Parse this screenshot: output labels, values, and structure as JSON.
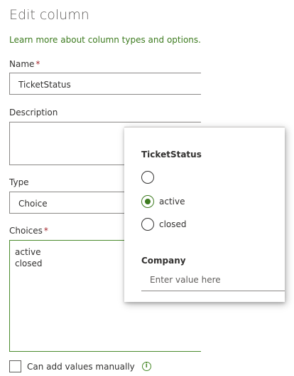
{
  "panel": {
    "title": "Edit column",
    "learn_link": "Learn more about column types and options."
  },
  "form": {
    "name": {
      "label": "Name",
      "required_mark": "*",
      "value": "TicketStatus"
    },
    "description": {
      "label": "Description",
      "value": ""
    },
    "type": {
      "label": "Type",
      "value": "Choice"
    },
    "choices": {
      "label": "Choices",
      "required_mark": "*",
      "values": [
        "active",
        "closed"
      ]
    },
    "manual": {
      "label": "Can add values manually",
      "checked": false,
      "info_icon": "info-icon"
    }
  },
  "popup": {
    "field_label": "TicketStatus",
    "options": [
      {
        "label": "",
        "selected": false
      },
      {
        "label": "active",
        "selected": true
      },
      {
        "label": "closed",
        "selected": false
      }
    ],
    "company_label": "Company",
    "company_placeholder": "Enter value here"
  },
  "colors": {
    "accent": "#3d7b1f",
    "required": "#a4262c",
    "border": "#8a8886"
  }
}
